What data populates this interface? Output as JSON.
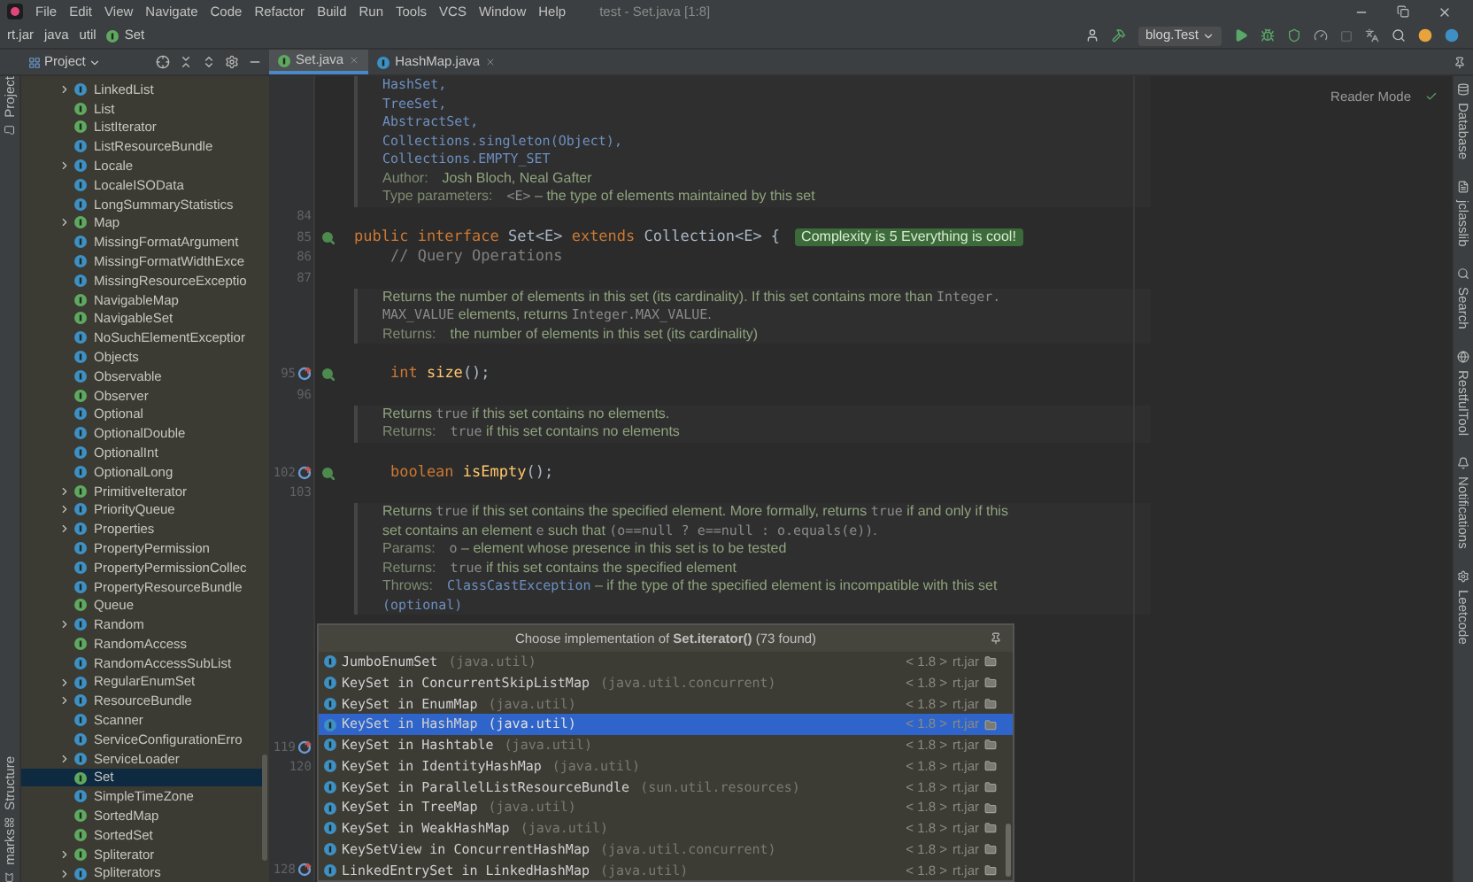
{
  "title_bar": {
    "menu": [
      "File",
      "Edit",
      "View",
      "Navigate",
      "Code",
      "Refactor",
      "Build",
      "Run",
      "Tools",
      "VCS",
      "Window",
      "Help"
    ],
    "title": "test - Set.java [1:8]"
  },
  "nav_bar": {
    "breadcrumbs": [
      {
        "label": "rt.jar",
        "kind": "jar"
      },
      {
        "label": "java",
        "kind": "package"
      },
      {
        "label": "util",
        "kind": "package"
      },
      {
        "label": "Set",
        "kind": "interface"
      }
    ],
    "run_config": "blog.Test"
  },
  "project_panel": {
    "title": "Project",
    "items": [
      {
        "label": "LinkedList",
        "kind": "class",
        "has_children": true,
        "selected": false
      },
      {
        "label": "List",
        "kind": "interface",
        "has_children": false,
        "selected": false
      },
      {
        "label": "ListIterator",
        "kind": "interface",
        "has_children": false,
        "selected": false
      },
      {
        "label": "ListResourceBundle",
        "kind": "class",
        "has_children": false,
        "selected": false
      },
      {
        "label": "Locale",
        "kind": "class",
        "has_children": true,
        "selected": false
      },
      {
        "label": "LocaleISOData",
        "kind": "class",
        "has_children": false,
        "selected": false
      },
      {
        "label": "LongSummaryStatistics",
        "kind": "class",
        "has_children": false,
        "selected": false
      },
      {
        "label": "Map",
        "kind": "interface",
        "has_children": true,
        "selected": false
      },
      {
        "label": "MissingFormatArgument",
        "kind": "class",
        "has_children": false,
        "selected": false
      },
      {
        "label": "MissingFormatWidthExce",
        "kind": "class",
        "has_children": false,
        "selected": false
      },
      {
        "label": "MissingResourceExceptio",
        "kind": "class",
        "has_children": false,
        "selected": false
      },
      {
        "label": "NavigableMap",
        "kind": "interface",
        "has_children": false,
        "selected": false
      },
      {
        "label": "NavigableSet",
        "kind": "interface",
        "has_children": false,
        "selected": false
      },
      {
        "label": "NoSuchElementExceptior",
        "kind": "class",
        "has_children": false,
        "selected": false
      },
      {
        "label": "Objects",
        "kind": "class",
        "has_children": false,
        "selected": false
      },
      {
        "label": "Observable",
        "kind": "class",
        "has_children": false,
        "selected": false
      },
      {
        "label": "Observer",
        "kind": "interface",
        "has_children": false,
        "selected": false
      },
      {
        "label": "Optional",
        "kind": "class",
        "has_children": false,
        "selected": false
      },
      {
        "label": "OptionalDouble",
        "kind": "class",
        "has_children": false,
        "selected": false
      },
      {
        "label": "OptionalInt",
        "kind": "class",
        "has_children": false,
        "selected": false
      },
      {
        "label": "OptionalLong",
        "kind": "class",
        "has_children": false,
        "selected": false
      },
      {
        "label": "PrimitiveIterator",
        "kind": "interface",
        "has_children": true,
        "selected": false
      },
      {
        "label": "PriorityQueue",
        "kind": "class",
        "has_children": true,
        "selected": false
      },
      {
        "label": "Properties",
        "kind": "class",
        "has_children": true,
        "selected": false
      },
      {
        "label": "PropertyPermission",
        "kind": "class",
        "has_children": false,
        "selected": false
      },
      {
        "label": "PropertyPermissionCollec",
        "kind": "class",
        "has_children": false,
        "selected": false
      },
      {
        "label": "PropertyResourceBundle",
        "kind": "class",
        "has_children": false,
        "selected": false
      },
      {
        "label": "Queue",
        "kind": "interface",
        "has_children": false,
        "selected": false
      },
      {
        "label": "Random",
        "kind": "class",
        "has_children": true,
        "selected": false
      },
      {
        "label": "RandomAccess",
        "kind": "interface",
        "has_children": false,
        "selected": false
      },
      {
        "label": "RandomAccessSubList",
        "kind": "class",
        "has_children": false,
        "selected": false
      },
      {
        "label": "RegularEnumSet",
        "kind": "class",
        "has_children": true,
        "selected": false
      },
      {
        "label": "ResourceBundle",
        "kind": "class",
        "has_children": true,
        "selected": false
      },
      {
        "label": "Scanner",
        "kind": "class",
        "has_children": false,
        "selected": false
      },
      {
        "label": "ServiceConfigurationErro",
        "kind": "class",
        "has_children": false,
        "selected": false
      },
      {
        "label": "ServiceLoader",
        "kind": "class",
        "has_children": true,
        "selected": false
      },
      {
        "label": "Set",
        "kind": "interface",
        "has_children": false,
        "selected": true
      },
      {
        "label": "SimpleTimeZone",
        "kind": "class",
        "has_children": false,
        "selected": false
      },
      {
        "label": "SortedMap",
        "kind": "interface",
        "has_children": false,
        "selected": false
      },
      {
        "label": "SortedSet",
        "kind": "interface",
        "has_children": false,
        "selected": false
      },
      {
        "label": "Spliterator",
        "kind": "interface",
        "has_children": true,
        "selected": false
      },
      {
        "label": "Spliterators",
        "kind": "class",
        "has_children": true,
        "selected": false
      }
    ]
  },
  "editor_tabs": [
    {
      "label": "Set.java",
      "kind": "interface",
      "selected": true
    },
    {
      "label": "HashMap.java",
      "kind": "class",
      "selected": false
    }
  ],
  "editor": {
    "reader_mode": "Reader Mode",
    "lines": [
      {
        "kind": "doc",
        "tokens": [
          {
            "text": "HashSet,",
            "kind": "link"
          }
        ]
      },
      {
        "kind": "doc",
        "tokens": [
          {
            "text": "TreeSet,",
            "kind": "link"
          }
        ]
      },
      {
        "kind": "doc",
        "tokens": [
          {
            "text": "AbstractSet,",
            "kind": "link"
          }
        ]
      },
      {
        "kind": "doc",
        "tokens": [
          {
            "text": "Collections.singleton(Object),",
            "kind": "link"
          }
        ]
      },
      {
        "kind": "doc",
        "tokens": [
          {
            "text": "Collections.EMPTY_SET",
            "kind": "link"
          }
        ]
      },
      {
        "kind": "doc",
        "tokens": [
          {
            "text": "Author:",
            "kind": "label"
          },
          {
            "text": "Josh Bloch, Neal Gafter",
            "kind": "text"
          }
        ]
      },
      {
        "kind": "doc",
        "tokens": [
          {
            "text": "Type parameters:",
            "kind": "label"
          },
          {
            "text": "<E>",
            "kind": "code"
          },
          {
            "text": " – the type of elements maintained by this set",
            "kind": "text"
          }
        ]
      },
      {
        "kind": "blank",
        "number": "84"
      },
      {
        "kind": "code",
        "number": "85",
        "overridden": false,
        "implemented": true,
        "inlay": "Complexity is 5 Everything is cool!",
        "tokens": [
          {
            "text": "public interface ",
            "kind": "keyword"
          },
          {
            "text": "Set<E> ",
            "kind": "name"
          },
          {
            "text": "extends ",
            "kind": "keyword"
          },
          {
            "text": "Collection<E> {",
            "kind": "name"
          }
        ]
      },
      {
        "kind": "code",
        "number": "86",
        "tokens": [
          {
            "text": "    // Query Operations",
            "kind": "comment"
          }
        ]
      },
      {
        "kind": "blank",
        "number": "87"
      },
      {
        "kind": "doc",
        "tokens": [
          {
            "text": "Returns the number of elements in this set (its cardinality). If this set contains more than ",
            "kind": "text"
          },
          {
            "text": "Integer.",
            "kind": "code"
          }
        ]
      },
      {
        "kind": "doc",
        "tokens": [
          {
            "text": "MAX_VALUE",
            "kind": "code"
          },
          {
            "text": " elements, returns ",
            "kind": "text"
          },
          {
            "text": "Integer.MAX_VALUE",
            "kind": "code"
          },
          {
            "text": ".",
            "kind": "text"
          }
        ]
      },
      {
        "kind": "doc",
        "tokens": [
          {
            "text": "Returns:",
            "kind": "label"
          },
          {
            "text": "the number of elements in this set (its cardinality)",
            "kind": "text"
          }
        ]
      },
      {
        "kind": "blank"
      },
      {
        "kind": "code",
        "number": "95",
        "overridden": true,
        "implemented": true,
        "tokens": [
          {
            "text": "    int ",
            "kind": "keyword"
          },
          {
            "text": "size",
            "kind": "method"
          },
          {
            "text": "();",
            "kind": "name"
          }
        ]
      },
      {
        "kind": "blank",
        "number": "96"
      },
      {
        "kind": "doc",
        "tokens": [
          {
            "text": "Returns ",
            "kind": "text"
          },
          {
            "text": "true",
            "kind": "code"
          },
          {
            "text": " if this set contains no elements.",
            "kind": "text"
          }
        ]
      },
      {
        "kind": "doc",
        "tokens": [
          {
            "text": "Returns:",
            "kind": "label"
          },
          {
            "text": "true",
            "kind": "code"
          },
          {
            "text": " if this set contains no elements",
            "kind": "text"
          }
        ]
      },
      {
        "kind": "blank"
      },
      {
        "kind": "code",
        "number": "102",
        "overridden": true,
        "implemented": true,
        "tokens": [
          {
            "text": "    boolean ",
            "kind": "keyword"
          },
          {
            "text": "isEmpty",
            "kind": "method"
          },
          {
            "text": "();",
            "kind": "name"
          }
        ]
      },
      {
        "kind": "blank",
        "number": "103"
      },
      {
        "kind": "doc",
        "tokens": [
          {
            "text": "Returns ",
            "kind": "text"
          },
          {
            "text": "true",
            "kind": "code"
          },
          {
            "text": " if this set contains the specified element. More formally, returns ",
            "kind": "text"
          },
          {
            "text": "true",
            "kind": "code"
          },
          {
            "text": " if and only if this",
            "kind": "text"
          }
        ]
      },
      {
        "kind": "doc",
        "tokens": [
          {
            "text": "set contains an element ",
            "kind": "text"
          },
          {
            "text": "e",
            "kind": "code"
          },
          {
            "text": " such that ",
            "kind": "text"
          },
          {
            "text": "(o==null ? e==null : o.equals(e))",
            "kind": "code"
          },
          {
            "text": ".",
            "kind": "text"
          }
        ]
      },
      {
        "kind": "doc",
        "tokens": [
          {
            "text": "Params:",
            "kind": "label"
          },
          {
            "text": "o",
            "kind": "code"
          },
          {
            "text": " – element whose presence in this set is to be tested",
            "kind": "text"
          }
        ]
      },
      {
        "kind": "doc",
        "tokens": [
          {
            "text": "Returns:",
            "kind": "label"
          },
          {
            "text": "true",
            "kind": "code"
          },
          {
            "text": " if this set contains the specified element",
            "kind": "text"
          }
        ]
      },
      {
        "kind": "doc",
        "tokens": [
          {
            "text": "Throws:",
            "kind": "label"
          },
          {
            "text": "ClassCastException",
            "kind": "link"
          },
          {
            "text": " – if the type of the specified element is incompatible with this set",
            "kind": "text"
          }
        ]
      },
      {
        "kind": "doc",
        "tokens": [
          {
            "text": "(optional)",
            "kind": "link"
          }
        ]
      },
      {
        "kind": "blank"
      },
      {
        "kind": "blank"
      },
      {
        "kind": "blank"
      },
      {
        "kind": "blank"
      },
      {
        "kind": "blank"
      },
      {
        "kind": "blank"
      },
      {
        "kind": "hidden",
        "number": "119",
        "overridden": true
      },
      {
        "kind": "blank",
        "number": "120"
      },
      {
        "kind": "blank"
      },
      {
        "kind": "blank"
      },
      {
        "kind": "blank"
      },
      {
        "kind": "blank"
      },
      {
        "kind": "hidden",
        "number": "128",
        "overridden": true
      }
    ]
  },
  "popup": {
    "title": "Choose implementation of **Set.iterator()** (73 found)",
    "items": [
      {
        "name": "JumboEnumSet",
        "package": "(java.util)",
        "version": "< 1.8 >",
        "library": "rt.jar",
        "selected": false
      },
      {
        "name": "KeySet in ConcurrentSkipListMap",
        "package": "(java.util.concurrent)",
        "version": "< 1.8 >",
        "library": "rt.jar",
        "selected": false
      },
      {
        "name": "KeySet in EnumMap",
        "package": "(java.util)",
        "version": "< 1.8 >",
        "library": "rt.jar",
        "selected": false
      },
      {
        "name": "KeySet in HashMap",
        "package": "(java.util)",
        "version": "< 1.8 >",
        "library": "rt.jar",
        "selected": true
      },
      {
        "name": "KeySet in Hashtable",
        "package": "(java.util)",
        "version": "< 1.8 >",
        "library": "rt.jar",
        "selected": false
      },
      {
        "name": "KeySet in IdentityHashMap",
        "package": "(java.util)",
        "version": "< 1.8 >",
        "library": "rt.jar",
        "selected": false
      },
      {
        "name": "KeySet in ParallelListResourceBundle",
        "package": "(sun.util.resources)",
        "version": "< 1.8 >",
        "library": "rt.jar",
        "selected": false
      },
      {
        "name": "KeySet in TreeMap",
        "package": "(java.util)",
        "version": "< 1.8 >",
        "library": "rt.jar",
        "selected": false
      },
      {
        "name": "KeySet in WeakHashMap",
        "package": "(java.util)",
        "version": "< 1.8 >",
        "library": "rt.jar",
        "selected": false
      },
      {
        "name": "KeySetView in ConcurrentHashMap",
        "package": "(java.util.concurrent)",
        "version": "< 1.8 >",
        "library": "rt.jar",
        "selected": false
      },
      {
        "name": "LinkedEntrySet in LinkedHashMap",
        "package": "(java.util)",
        "version": "< 1.8 >",
        "library": "rt.jar",
        "selected": false
      }
    ]
  },
  "left_stripe": {
    "top": [
      "Project"
    ],
    "bottom": [
      "Structure",
      "marks"
    ]
  },
  "right_stripe": [
    "Database",
    "jclasslib",
    "Search",
    "RestfulTool",
    "Notifications",
    "Leetcode"
  ]
}
